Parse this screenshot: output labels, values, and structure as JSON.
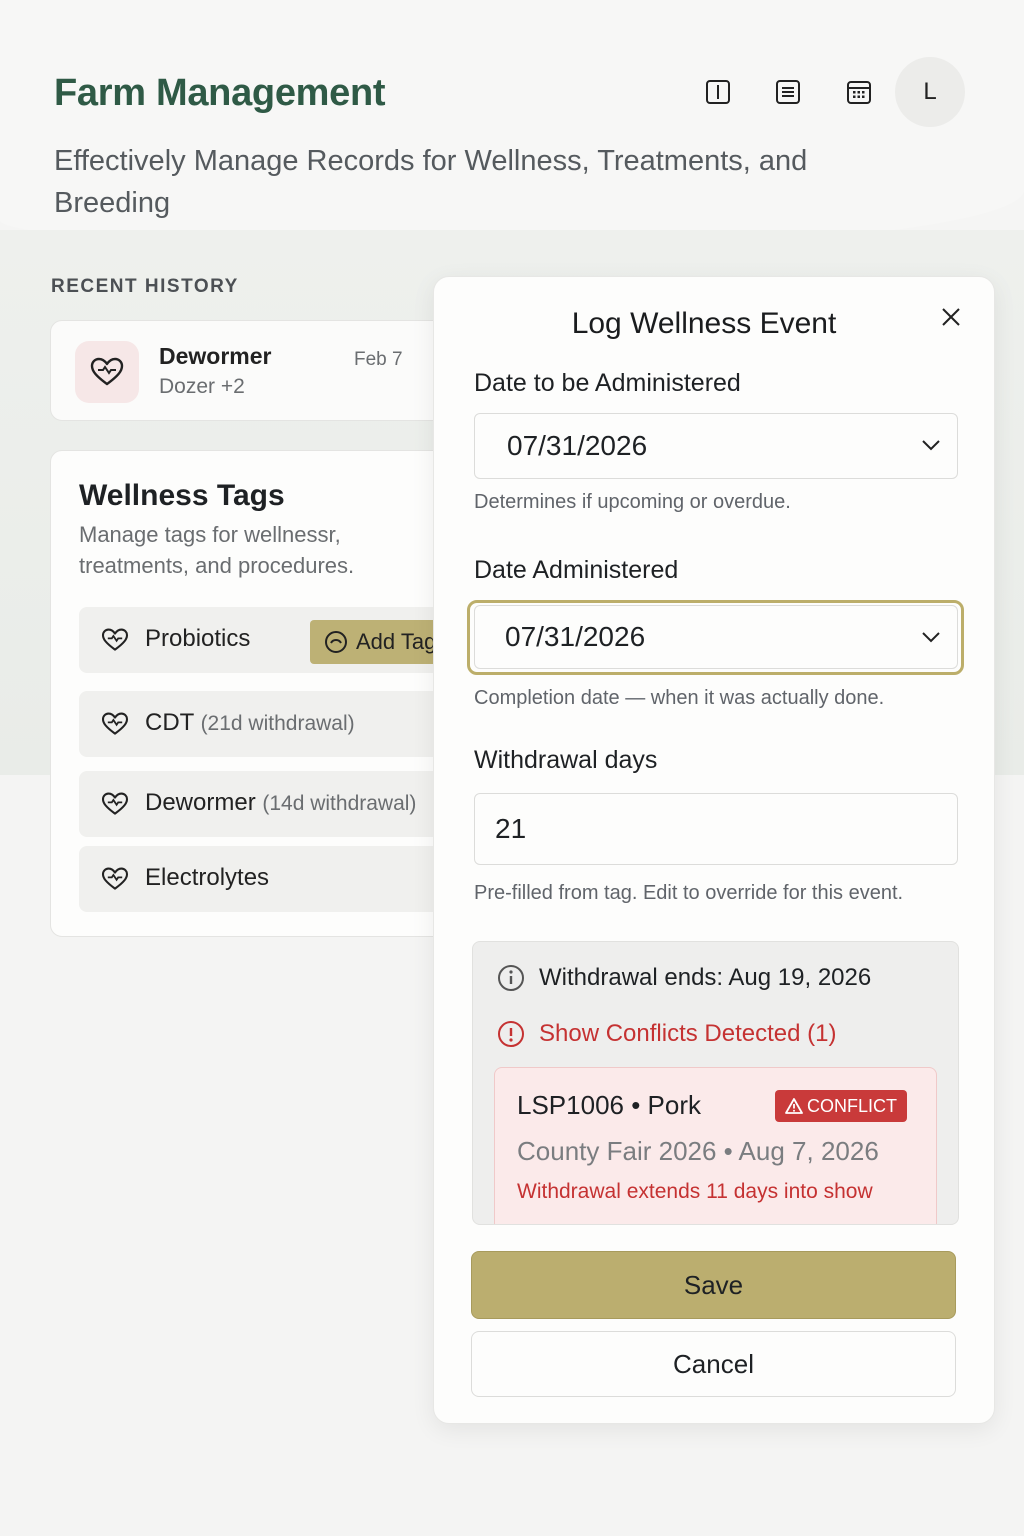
{
  "header": {
    "title": "Farm Management",
    "subtitle": "Effectively Manage Records for Wellness, Treatments, and Breeding",
    "avatar_initial": "L",
    "icons": [
      "sidebar-toggle-icon",
      "list-icon",
      "calendar-icon"
    ]
  },
  "recent_history": {
    "label": "RECENT HISTORY",
    "item": {
      "title": "Dewormer",
      "subtitle": "Dozer +2",
      "date": "Feb 7",
      "icon": "heart-icon"
    }
  },
  "wellness_tags": {
    "title": "Wellness Tags",
    "description": "Manage tags for wellnessr, treatments, and procedures.",
    "add_tag_label": "Add Tag",
    "items": [
      {
        "name": "Probiotics",
        "withdrawal": ""
      },
      {
        "name": "CDT",
        "withdrawal": "(21d withdrawal)"
      },
      {
        "name": "Dewormer",
        "withdrawal": "(14d withdrawal)"
      },
      {
        "name": "Electrolytes",
        "withdrawal": ""
      }
    ]
  },
  "modal": {
    "title": "Log Wellness Event",
    "date_to_administer": {
      "label": "Date to be Administered",
      "value": "07/31/2026",
      "help": "Determines if upcoming or overdue."
    },
    "date_administered": {
      "label": "Date Administered",
      "value": "07/31/2026",
      "help": "Completion date — when it was actually done."
    },
    "withdrawal_days": {
      "label": "Withdrawal days",
      "value": "21",
      "help": "Pre-filled from tag. Edit to override for this event."
    },
    "info": {
      "withdrawal_ends_label": "Withdrawal ends:",
      "withdrawal_ends_value": "Aug 19, 2026",
      "conflicts_link": "Show Conflicts Detected (1)",
      "conflict": {
        "title": "LSP1006 • Pork",
        "badge": "CONFLICT",
        "subtitle": "County Fair 2026 • Aug 7, 2026",
        "warning": "Withdrawal extends 11 days into show"
      }
    },
    "save_label": "Save",
    "cancel_label": "Cancel"
  },
  "colors": {
    "brand_green": "#2f5a46",
    "accent_olive": "#bbae6f",
    "conflict_red": "#c93a3a"
  }
}
